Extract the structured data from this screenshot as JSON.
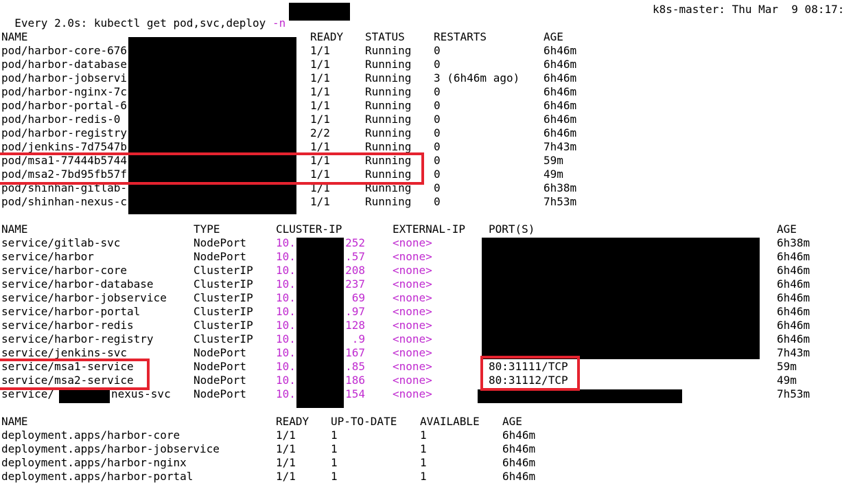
{
  "header": {
    "prefix": "Every 2.0s: kubectl get pod,svc,deploy ",
    "flag": "-n",
    "host_time": "k8s-master: Thu Mar  9 08:17:"
  },
  "colors": {
    "ip": "#c02bd0",
    "highlight": "#e5232f",
    "background": "#ffffff",
    "text": "#000000",
    "redaction": "#000000"
  },
  "pods": {
    "headers": [
      "NAME",
      "READY",
      "STATUS",
      "RESTARTS",
      "AGE"
    ],
    "rows": [
      [
        "pod/harbor-core-676",
        "1/1",
        "Running",
        "0",
        "6h46m"
      ],
      [
        "pod/harbor-database",
        "1/1",
        "Running",
        "0",
        "6h46m"
      ],
      [
        "pod/harbor-jobservi",
        "1/1",
        "Running",
        "3 (6h46m ago)",
        "6h46m"
      ],
      [
        "pod/harbor-nginx-7c",
        "1/1",
        "Running",
        "0",
        "6h46m"
      ],
      [
        "pod/harbor-portal-6",
        "1/1",
        "Running",
        "0",
        "6h46m"
      ],
      [
        "pod/harbor-redis-0",
        "1/1",
        "Running",
        "0",
        "6h46m"
      ],
      [
        "pod/harbor-registry",
        "2/2",
        "Running",
        "0",
        "6h46m"
      ],
      [
        "pod/jenkins-7d7547b",
        "1/1",
        "Running",
        "0",
        "7h43m"
      ],
      [
        "pod/msa1-77444b5744",
        "1/1",
        "Running",
        "0",
        "59m"
      ],
      [
        "pod/msa2-7bd95fb57f",
        "1/1",
        "Running",
        "0",
        "49m"
      ],
      [
        "pod/shinhan-gitlab-",
        "1/1",
        "Running",
        "0",
        "6h38m"
      ],
      [
        "pod/shinhan-nexus-c",
        "1/1",
        "Running",
        "0",
        "7h53m"
      ]
    ]
  },
  "services": {
    "headers": [
      "NAME",
      "TYPE",
      "CLUSTER-IP",
      "EXTERNAL-IP",
      "PORT(S)",
      "AGE"
    ],
    "rows": [
      [
        "service/gitlab-svc",
        "NodePort",
        "10.",
        "252",
        "<none>",
        "",
        "6h38m"
      ],
      [
        "service/harbor",
        "NodePort",
        "10.",
        ".57",
        "<none>",
        "",
        "6h46m"
      ],
      [
        "service/harbor-core",
        "ClusterIP",
        "10.",
        "208",
        "<none>",
        "",
        "6h46m"
      ],
      [
        "service/harbor-database",
        "ClusterIP",
        "10.",
        "237",
        "<none>",
        "",
        "6h46m"
      ],
      [
        "service/harbor-jobservice",
        "ClusterIP",
        "10.",
        "69",
        "<none>",
        "",
        "6h46m"
      ],
      [
        "service/harbor-portal",
        "ClusterIP",
        "10.",
        ".97",
        "<none>",
        "",
        "6h46m"
      ],
      [
        "service/harbor-redis",
        "ClusterIP",
        "10.",
        "128",
        "<none>",
        "",
        "6h46m"
      ],
      [
        "service/harbor-registry",
        "ClusterIP",
        "10.",
        ".9",
        "<none>",
        "",
        "6h46m"
      ],
      [
        "service/jenkins-svc",
        "NodePort",
        "10.",
        ".167",
        "<none>",
        "",
        "7h43m"
      ],
      [
        "service/msa1-service",
        "NodePort",
        "10.",
        ".85",
        "<none>",
        "80:31111/TCP",
        "59m"
      ],
      [
        "service/msa2-service",
        "NodePort",
        "10.",
        ".186",
        "<none>",
        "80:31112/TCP",
        "49m"
      ],
      [
        "service/",
        "NodePort",
        "10.",
        "154",
        "<none>",
        "",
        "7h53m"
      ]
    ],
    "last_name_suffix": "nexus-svc"
  },
  "deployments": {
    "headers": [
      "NAME",
      "READY",
      "UP-TO-DATE",
      "AVAILABLE",
      "AGE"
    ],
    "rows": [
      [
        "deployment.apps/harbor-core",
        "1/1",
        "1",
        "1",
        "6h46m"
      ],
      [
        "deployment.apps/harbor-jobservice",
        "1/1",
        "1",
        "1",
        "6h46m"
      ],
      [
        "deployment.apps/harbor-nginx",
        "1/1",
        "1",
        "1",
        "6h46m"
      ],
      [
        "deployment.apps/harbor-portal",
        "1/1",
        "1",
        "1",
        "6h46m"
      ]
    ]
  }
}
